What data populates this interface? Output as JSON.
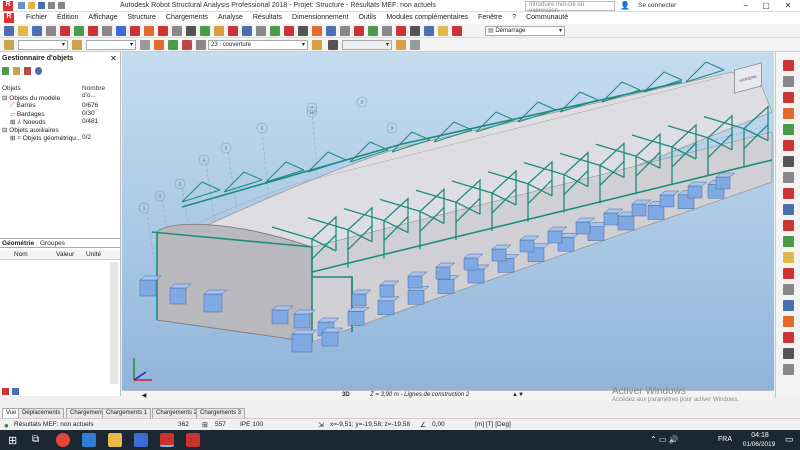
{
  "window": {
    "title": "Autodesk Robot Structural Analysis Professional 2018 - Projet: Structure - Résultats MEF: non actuels"
  },
  "menu": {
    "items": [
      "Fichier",
      "Édition",
      "Affichage",
      "Structure",
      "Chargements",
      "Analyse",
      "Résultats",
      "Dimensionnement",
      "Outils",
      "Modules complémentaires",
      "Fenêtre",
      "?",
      "Communauté"
    ],
    "search_placeholder": "Introduire mot-clé ou expression",
    "connect_label": "Se connecter"
  },
  "toolbar": {
    "layout_select": "Démarrage",
    "case_select": "23 : couverture"
  },
  "object_manager": {
    "title": "Gestionnaire d'objets",
    "col_objects": "Objets",
    "col_count": "Nombre d'o...",
    "model_objects": "Objets du modèle",
    "bars_label": "Barres",
    "bars_count": "0/676",
    "cladding_label": "Bardages",
    "cladding_count": "0/30",
    "nodes_label": "Noeuds",
    "nodes_count": "0/481",
    "aux_objects": "Objets auxiliaires",
    "geom_label": "Objets géométriqu...",
    "geom_count": "0/2",
    "tab_geometry": "Géométrie",
    "tab_groups": "Groupes",
    "prop_col_name": "Nom",
    "prop_col_value": "Valeur",
    "prop_col_unit": "Unité"
  },
  "viewport": {
    "view_label": "3D",
    "plane_label": "Z = 3,90 m - Lignes de construction 2",
    "axis_labels": [
      "1",
      "2",
      "3",
      "4",
      "5",
      "6",
      "7",
      "8",
      "9",
      "10"
    ],
    "gizmo_label": "ARRIÈRE"
  },
  "bottom_tabs": [
    "Vue",
    "Déplacements",
    "Chargements",
    "Chargements 1",
    "Chargements 2",
    "Chargements 3"
  ],
  "status": {
    "results": "Résultats MEF: non actuels",
    "count1": "362",
    "count2": "557",
    "section": "IPE 100",
    "coords": "x=-9,51; y=-19,58; z=-19,58",
    "angle": "0,00",
    "units": "[m] [T] [Deg]"
  },
  "watermark": {
    "line1": "Activer Windows",
    "line2": "Accédez aux paramètres pour activer Windows."
  },
  "taskbar": {
    "lang": "FRA",
    "time": "04:18",
    "date": "01/06/2019"
  },
  "colors": {
    "steel": "#1c8c7c",
    "roof": "#c8c8cc",
    "support": "#7fa9e3",
    "sky_top": "#c5dcef"
  }
}
